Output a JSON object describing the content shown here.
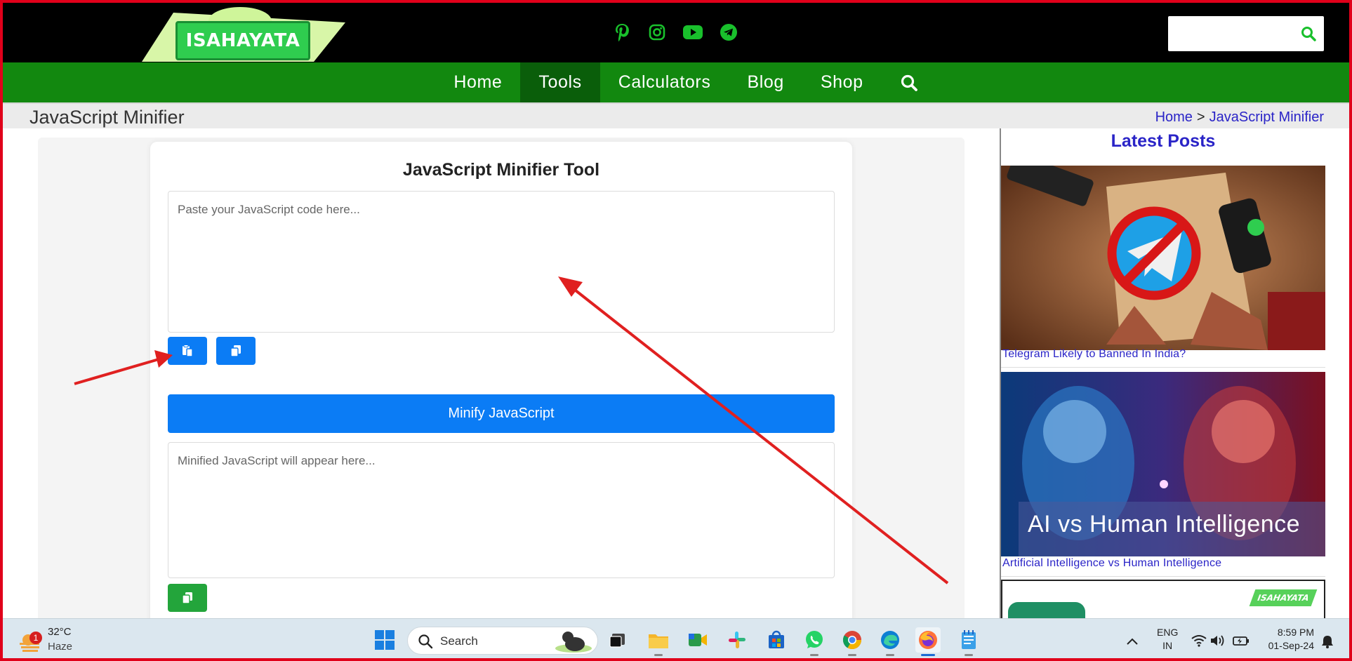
{
  "header": {
    "logo_text": "ISAHAYATA",
    "socials": [
      "pinterest-icon",
      "instagram-icon",
      "youtube-icon",
      "telegram-icon"
    ],
    "search": {
      "placeholder": "",
      "icon": "search-icon"
    }
  },
  "nav": {
    "items": [
      {
        "label": "Home",
        "active": false
      },
      {
        "label": "Tools",
        "active": true
      },
      {
        "label": "Calculators",
        "active": false
      },
      {
        "label": "Blog",
        "active": false
      },
      {
        "label": "Shop",
        "active": false
      }
    ]
  },
  "titlebar": {
    "title": "JavaScript Minifier",
    "breadcrumb": {
      "home": "Home",
      "sep": ">",
      "current": "JavaScript Minifier"
    }
  },
  "tool": {
    "title": "JavaScript Minifier Tool",
    "input_placeholder": "Paste your JavaScript code here...",
    "minify_label": "Minify JavaScript",
    "output_placeholder": "Minified JavaScript will appear here..."
  },
  "sidebar": {
    "title": "Latest Posts",
    "posts": [
      {
        "title": "Telegram Likely to Banned In India?"
      },
      {
        "title": "Artificial Intelligence vs Human Intelligence",
        "image_caption": "AI vs Human Intelligence"
      }
    ],
    "third_post_badge": "ISAHAYATA"
  },
  "taskbar": {
    "weather": {
      "temp": "32°C",
      "condition": "Haze",
      "badge": "1"
    },
    "search_label": "Search",
    "lang": {
      "line1": "ENG",
      "line2": "IN"
    },
    "time": "8:59 PM",
    "date": "01-Sep-24"
  },
  "colors": {
    "nav_green": "#12880f",
    "nav_active": "#0a5e0a",
    "primary_blue": "#0b7cf5",
    "copy_green": "#23a53b",
    "link_blue": "#2a24c7",
    "frame_red": "#e0001a"
  }
}
